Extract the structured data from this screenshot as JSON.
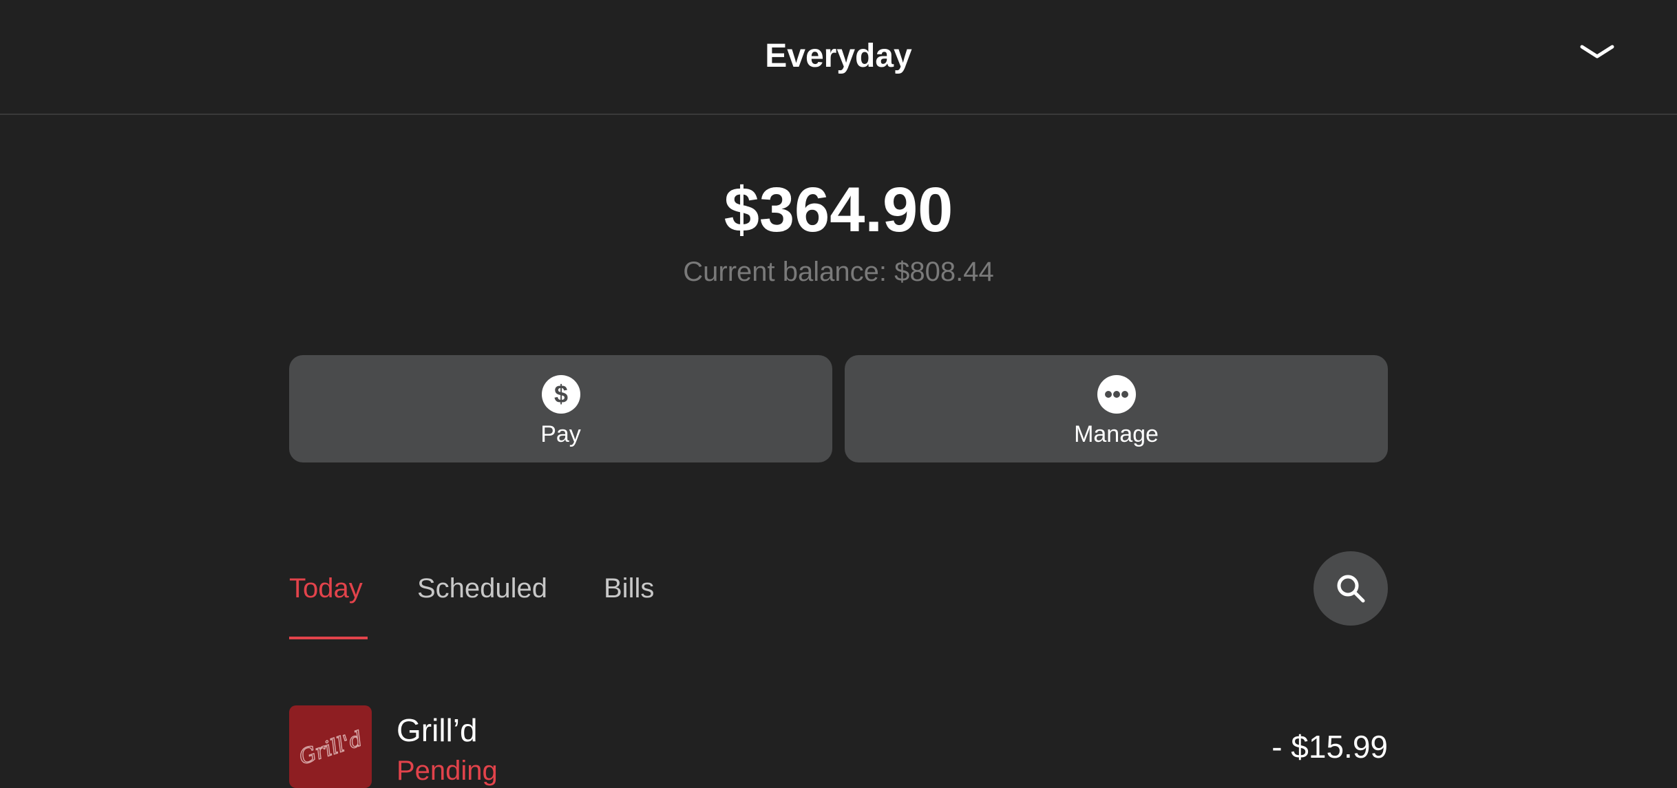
{
  "header": {
    "title": "Everyday",
    "collapse_icon": "chevron-down-icon"
  },
  "balance": {
    "available": "$364.90",
    "current": "Current balance: $808.44"
  },
  "actions": [
    {
      "label": "Pay",
      "icon": "dollar-icon"
    },
    {
      "label": "Manage",
      "icon": "more-icon"
    }
  ],
  "tabs": [
    {
      "label": "Today",
      "active": true
    },
    {
      "label": "Scheduled",
      "active": false
    },
    {
      "label": "Bills",
      "active": false
    }
  ],
  "search": {
    "icon": "search-icon"
  },
  "transactions": [
    {
      "logo_text": "Grill'd",
      "name": "Grill’d",
      "status": "Pending",
      "amount": "- $15.99"
    }
  ],
  "colors": {
    "background": "#212121",
    "button": "#4a4b4c",
    "accent": "#e2434b",
    "muted": "#7a7a7a",
    "logo_bg": "#8e1e22"
  }
}
